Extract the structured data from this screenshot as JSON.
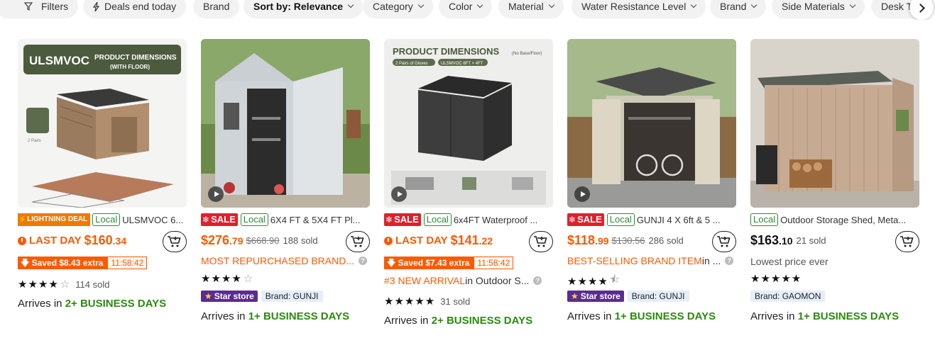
{
  "filters": {
    "items": [
      {
        "label": "Filters",
        "icon": "filter-icon"
      },
      {
        "label": "Deals end today",
        "icon": "lightning-icon"
      },
      {
        "label": "Brand"
      },
      {
        "label": "Sort by: Relevance"
      },
      {
        "label": "Category"
      },
      {
        "label": "Color"
      },
      {
        "label": "Material"
      },
      {
        "label": "Water Resistance Level"
      },
      {
        "label": "Brand"
      },
      {
        "label": "Side Materials"
      },
      {
        "label": "Desk T"
      }
    ],
    "scroll_icon": "chevron-right-icon"
  },
  "products": [
    {
      "badges": {
        "lightning": "LIGHTNING DEAL",
        "local": "Local"
      },
      "title": "ULSMVOC 6...",
      "image_text": {
        "brand": "ULSMVOC",
        "headline": "PRODUCT DIMENSIONS",
        "subline": "(WITH FLOOR)",
        "gloves": "2 Pairs of Gloves"
      },
      "last_day": "LAST DAY",
      "price_main": "$160",
      "price_cents": ".34",
      "saved": "Saved $8.43 extra",
      "timer": "11:58:42",
      "rating_count": "114 sold",
      "arrives_prefix": "Arrives in ",
      "arrives_days": "2+ BUSINESS DAYS"
    },
    {
      "badges": {
        "sale": "SALE",
        "local": "Local"
      },
      "title": "6X4 FT & 5X4 FT Pl...",
      "price_main": "$276",
      "price_cents": ".79",
      "was": "$668.90",
      "sold": "188 sold",
      "promo": "MOST REPURCHASED BRAND...",
      "store": "Star store",
      "brand": "Brand: GUNJI",
      "arrives_prefix": "Arrives in ",
      "arrives_days": "1+ BUSINESS DAYS"
    },
    {
      "badges": {
        "sale": "SALE",
        "local": "Local"
      },
      "title": "6x4FT Waterproof ...",
      "image_text": {
        "headline": "PRODUCT DIMENSIONS",
        "note": "(No Base/Floor)",
        "tag1": "2 Pairs of Gloves",
        "tag2": "ULSMVOC 6FT × 4FT"
      },
      "last_day": "LAST DAY",
      "price_main": "$141",
      "price_cents": ".22",
      "saved": "Saved $7.43 extra",
      "timer": "11:58:42",
      "promo_orange": "#3 NEW ARRIVAL",
      "promo_rest": " in Outdoor S...",
      "rating_count": "31 sold",
      "arrives_prefix": "Arrives in ",
      "arrives_days": "2+ BUSINESS DAYS"
    },
    {
      "badges": {
        "sale": "SALE",
        "local": "Local"
      },
      "title": "GUNJI 4 X 6ft & 5 ...",
      "price_main": "$118",
      "price_cents": ".99",
      "was": "$130.56",
      "sold": "286 sold",
      "promo_orange": "BEST-SELLING BRAND ITEM",
      "promo_rest": " in ...",
      "store": "Star store",
      "brand": "Brand: GUNJI",
      "arrives_prefix": "Arrives in ",
      "arrives_days": "1+ BUSINESS DAYS"
    },
    {
      "badges": {
        "local": "Local"
      },
      "title": "Outdoor Storage Shed, Meta...",
      "price_main": "$163",
      "price_cents": ".10",
      "sold": "21 sold",
      "lowest": "Lowest price ever",
      "brand": "Brand: GAOMON",
      "arrives_prefix": "Arrives in ",
      "arrives_days": "1+ BUSINESS DAYS"
    }
  ],
  "ratings": [
    4.5,
    4,
    5,
    4.5,
    5
  ],
  "colors": {
    "accent_orange": "#fb5a00",
    "sale_red": "#e0202c",
    "local_green": "#2a8a3a",
    "star_store_purple": "#5a2c91",
    "arrive_green": "#2c8a0e"
  }
}
